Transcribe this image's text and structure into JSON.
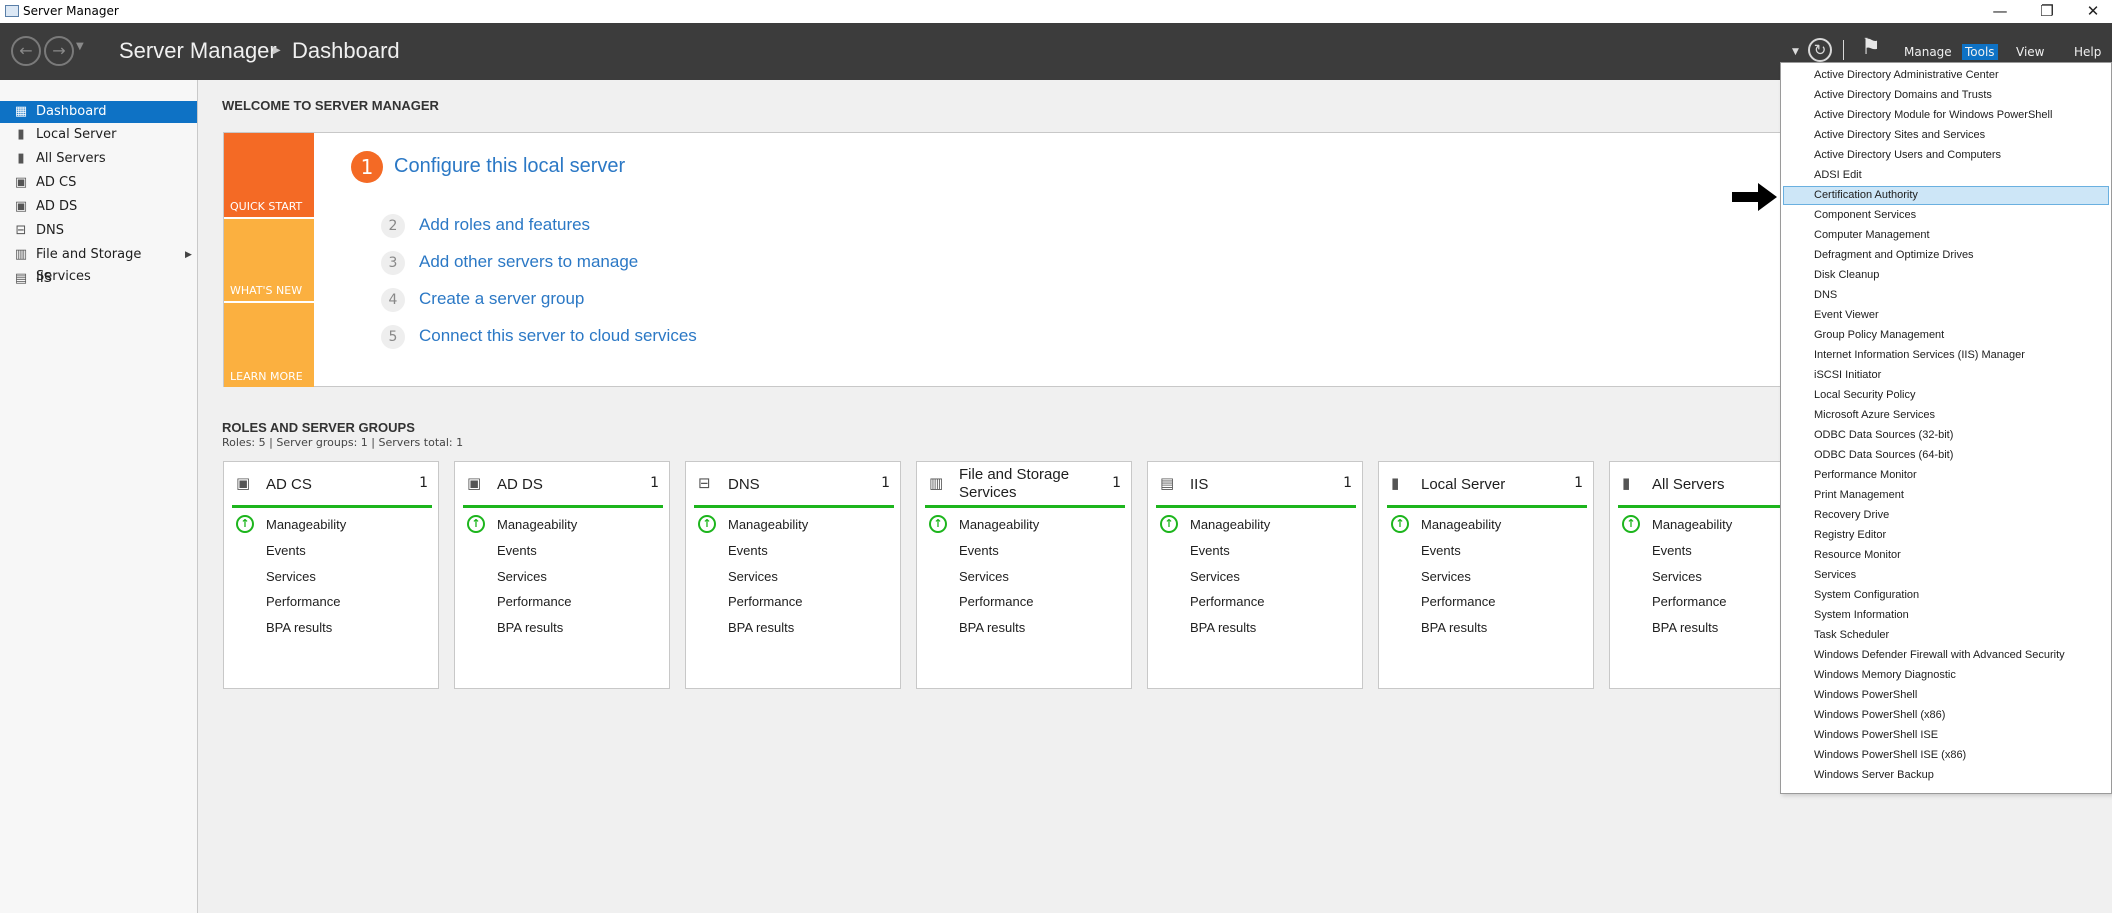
{
  "window": {
    "title": "Server Manager",
    "controls": {
      "minimize": "—",
      "restore": "❐",
      "close": "✕"
    }
  },
  "header": {
    "app_name": "Server Manager",
    "page": "Dashboard",
    "menus": {
      "manage": "Manage",
      "tools": "Tools",
      "view": "View",
      "help": "Help"
    }
  },
  "sidebar": {
    "items": [
      {
        "label": "Dashboard",
        "icon": "dashboard-grid-icon",
        "glyph": "▦"
      },
      {
        "label": "Local Server",
        "icon": "server-icon",
        "glyph": "▮"
      },
      {
        "label": "All Servers",
        "icon": "servers-icon",
        "glyph": "▮"
      },
      {
        "label": "AD CS",
        "icon": "ad-cs-icon",
        "glyph": "▣"
      },
      {
        "label": "AD DS",
        "icon": "ad-ds-icon",
        "glyph": "▣"
      },
      {
        "label": "DNS",
        "icon": "dns-icon",
        "glyph": "⊟"
      },
      {
        "label": "File and Storage Services",
        "icon": "file-storage-icon",
        "glyph": "▥"
      },
      {
        "label": "IIS",
        "icon": "iis-icon",
        "glyph": "▤"
      }
    ]
  },
  "welcome": {
    "heading": "WELCOME TO SERVER MANAGER",
    "tiles": {
      "quick_start": "QUICK START",
      "whats_new": "WHAT'S NEW",
      "learn_more": "LEARN MORE"
    },
    "main_step": {
      "number": "1",
      "label": "Configure this local server"
    },
    "steps": [
      {
        "number": "2",
        "label": "Add roles and features"
      },
      {
        "number": "3",
        "label": "Add other servers to manage"
      },
      {
        "number": "4",
        "label": "Create a server group"
      },
      {
        "number": "5",
        "label": "Connect this server to cloud services"
      }
    ]
  },
  "roles": {
    "heading": "ROLES AND SERVER GROUPS",
    "summary": "Roles: 5   |   Server groups: 1   |   Servers total: 1",
    "cards": [
      {
        "title": "AD CS",
        "count": "1",
        "icon": "ad-cs-icon",
        "glyph": "▣",
        "rows": [
          "Manageability",
          "Events",
          "Services",
          "Performance",
          "BPA results"
        ]
      },
      {
        "title": "AD DS",
        "count": "1",
        "icon": "ad-ds-icon",
        "glyph": "▣",
        "rows": [
          "Manageability",
          "Events",
          "Services",
          "Performance",
          "BPA results"
        ]
      },
      {
        "title": "DNS",
        "count": "1",
        "icon": "dns-icon",
        "glyph": "⊟",
        "rows": [
          "Manageability",
          "Events",
          "Services",
          "Performance",
          "BPA results"
        ]
      },
      {
        "title": "File and Storage Services",
        "count": "1",
        "icon": "file-storage-icon",
        "glyph": "▥",
        "rows": [
          "Manageability",
          "Events",
          "Services",
          "Performance",
          "BPA results"
        ]
      },
      {
        "title": "IIS",
        "count": "1",
        "icon": "iis-icon",
        "glyph": "▤",
        "rows": [
          "Manageability",
          "Events",
          "Services",
          "Performance",
          "BPA results"
        ]
      },
      {
        "title": "Local Server",
        "count": "1",
        "icon": "server-icon",
        "glyph": "▮",
        "rows": [
          "Manageability",
          "Events",
          "Services",
          "Performance",
          "BPA results"
        ]
      },
      {
        "title": "All Servers",
        "count": "",
        "icon": "servers-icon",
        "glyph": "▮",
        "rows": [
          "Manageability",
          "Events",
          "Services",
          "Performance",
          "BPA results"
        ]
      }
    ]
  },
  "tools_menu": {
    "highlighted": "Certification Authority",
    "items": [
      "Active Directory Administrative Center",
      "Active Directory Domains and Trusts",
      "Active Directory Module for Windows PowerShell",
      "Active Directory Sites and Services",
      "Active Directory Users and Computers",
      "ADSI Edit",
      "Certification Authority",
      "Component Services",
      "Computer Management",
      "Defragment and Optimize Drives",
      "Disk Cleanup",
      "DNS",
      "Event Viewer",
      "Group Policy Management",
      "Internet Information Services (IIS) Manager",
      "iSCSI Initiator",
      "Local Security Policy",
      "Microsoft Azure Services",
      "ODBC Data Sources (32-bit)",
      "ODBC Data Sources (64-bit)",
      "Performance Monitor",
      "Print Management",
      "Recovery Drive",
      "Registry Editor",
      "Resource Monitor",
      "Services",
      "System Configuration",
      "System Information",
      "Task Scheduler",
      "Windows Defender Firewall with Advanced Security",
      "Windows Memory Diagnostic",
      "Windows PowerShell",
      "Windows PowerShell (x86)",
      "Windows PowerShell ISE",
      "Windows PowerShell ISE (x86)",
      "Windows Server Backup"
    ]
  },
  "colors": {
    "header_bg": "#3c3c3c",
    "accent_blue": "#0e72c5",
    "quick_start_orange": "#f46a25",
    "tile_amber": "#fbb040",
    "status_green": "#1db51d",
    "link_blue": "#2b78c5"
  }
}
